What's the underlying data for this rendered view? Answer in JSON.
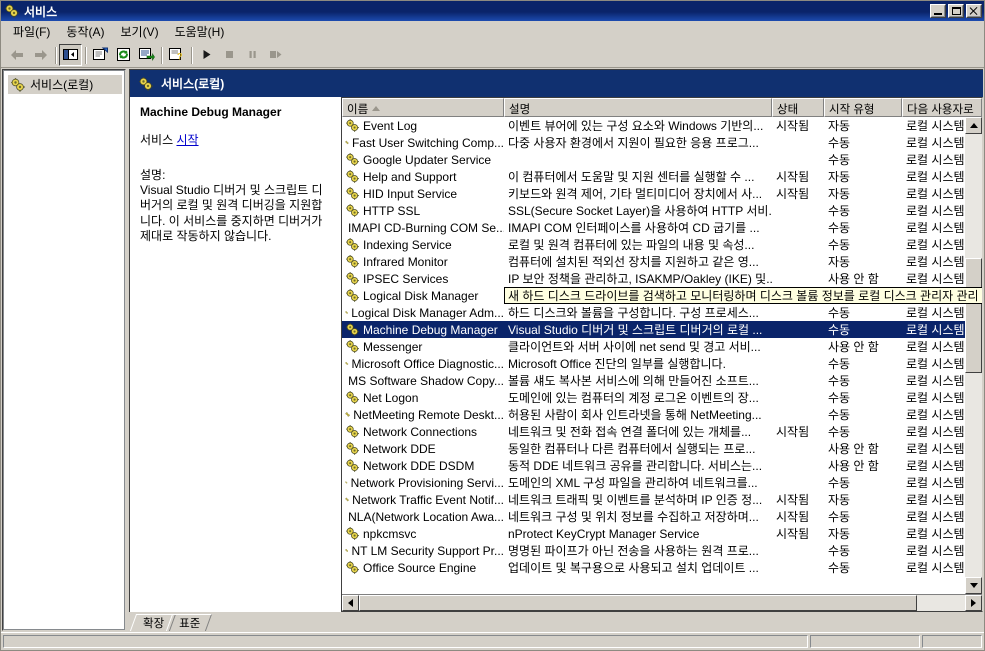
{
  "window": {
    "title": "서비스",
    "icon": "services-gear-icon",
    "buttons": {
      "minimize": "최소화",
      "maximize": "최대화",
      "close": "닫기"
    }
  },
  "menu": [
    {
      "label": "파일(F)",
      "name": "menu-file"
    },
    {
      "label": "동작(A)",
      "name": "menu-action"
    },
    {
      "label": "보기(V)",
      "name": "menu-view"
    },
    {
      "label": "도움말(H)",
      "name": "menu-help"
    }
  ],
  "toolbar": [
    {
      "name": "back-button",
      "icon": "arrow-left-icon",
      "enabled": false
    },
    {
      "name": "forward-button",
      "icon": "arrow-right-icon",
      "enabled": false
    },
    {
      "name": "show-hide-tree-button",
      "icon": "tree-pane-icon",
      "pressed": true
    },
    {
      "name": "properties-button",
      "icon": "properties-icon"
    },
    {
      "name": "refresh-button",
      "icon": "refresh-icon"
    },
    {
      "name": "export-list-button",
      "icon": "export-list-icon"
    },
    {
      "name": "help-button",
      "icon": "help-question-icon"
    },
    {
      "name": "start-service-button",
      "icon": "play-icon"
    },
    {
      "name": "stop-service-button",
      "icon": "stop-icon"
    },
    {
      "name": "pause-service-button",
      "icon": "pause-icon"
    },
    {
      "name": "restart-service-button",
      "icon": "restart-icon"
    }
  ],
  "tree": {
    "root_label": "서비스(로컬)",
    "root_icon": "services-gear-icon"
  },
  "banner": {
    "title": "서비스(로컬)",
    "icon": "services-gear-icon"
  },
  "detail": {
    "service_name": "Machine Debug Manager",
    "action_prefix": "서비스 ",
    "action_link": "시작",
    "description_label": "설명:",
    "description": "Visual Studio 디버거 및 스크립트 디버거의 로컬 및 원격 디버깅을 지원합니다. 이 서비스를 중지하면 디버거가 제대로 작동하지 않습니다."
  },
  "list": {
    "columns": [
      {
        "label": "이름",
        "name": "column-name",
        "sorted": true
      },
      {
        "label": "설명",
        "name": "column-description"
      },
      {
        "label": "상태",
        "name": "column-status"
      },
      {
        "label": "시작 유형",
        "name": "column-startup-type"
      },
      {
        "label": "다음 사용자로",
        "name": "column-log-on-as"
      }
    ],
    "rows": [
      {
        "name": "Event Log",
        "desc": "이벤트 뷰어에 있는 구성 요소와 Windows 기반의...",
        "status": "시작됨",
        "startup": "자동",
        "logon": "로컬 시스템"
      },
      {
        "name": "Fast User Switching Comp...",
        "desc": "다중 사용자 환경에서 지원이 필요한 응용 프로그...",
        "status": "",
        "startup": "수동",
        "logon": "로컬 시스템"
      },
      {
        "name": "Google Updater Service",
        "desc": "",
        "status": "",
        "startup": "수동",
        "logon": "로컬 시스템"
      },
      {
        "name": "Help and Support",
        "desc": "이 컴퓨터에서 도움말 및 지원 센터를 실행할 수 ...",
        "status": "시작됨",
        "startup": "자동",
        "logon": "로컬 시스템"
      },
      {
        "name": "HID Input Service",
        "desc": "키보드와 원격 제어, 기타 멀티미디어 장치에서 사...",
        "status": "시작됨",
        "startup": "자동",
        "logon": "로컬 시스템"
      },
      {
        "name": "HTTP SSL",
        "desc": "SSL(Secure Socket Layer)을 사용하여 HTTP 서비...",
        "status": "",
        "startup": "수동",
        "logon": "로컬 시스템"
      },
      {
        "name": "IMAPI CD-Burning COM Se...",
        "desc": "IMAPI COM 인터페이스를 사용하여 CD 굽기를 ...",
        "status": "",
        "startup": "수동",
        "logon": "로컬 시스템"
      },
      {
        "name": "Indexing Service",
        "desc": "로컬 및 원격 컴퓨터에 있는 파일의 내용 및 속성...",
        "status": "",
        "startup": "수동",
        "logon": "로컬 시스템"
      },
      {
        "name": "Infrared Monitor",
        "desc": "컴퓨터에 설치된 적외선 장치를 지원하고 같은 영...",
        "status": "",
        "startup": "자동",
        "logon": "로컬 시스템"
      },
      {
        "name": "IPSEC Services",
        "desc": "IP 보안 정책을 관리하고, ISAKMP/Oakley (IKE) 및...",
        "status": "",
        "startup": "사용 안 함",
        "logon": "로컬 시스템"
      },
      {
        "name": "Logical Disk Manager",
        "desc": "",
        "status": "",
        "startup": "",
        "logon": ""
      },
      {
        "name": "Logical Disk Manager Adm...",
        "desc": "하드 디스크와 볼륨을 구성합니다. 구성 프로세스...",
        "status": "",
        "startup": "수동",
        "logon": "로컬 시스템"
      },
      {
        "name": "Machine Debug Manager",
        "desc": "Visual Studio 디버거 및 스크립트 디버거의 로컬 ...",
        "status": "",
        "startup": "수동",
        "logon": "로컬 시스템",
        "selected": true
      },
      {
        "name": "Messenger",
        "desc": "클라이언트와 서버 사이에 net send 및 경고 서비...",
        "status": "",
        "startup": "사용 안 함",
        "logon": "로컬 시스템"
      },
      {
        "name": "Microsoft Office Diagnostic...",
        "desc": "Microsoft Office 진단의 일부를 실행합니다.",
        "status": "",
        "startup": "수동",
        "logon": "로컬 시스템"
      },
      {
        "name": "MS Software Shadow Copy...",
        "desc": "볼륨 섀도 복사본 서비스에 의해 만들어진 소프트...",
        "status": "",
        "startup": "수동",
        "logon": "로컬 시스템"
      },
      {
        "name": "Net Logon",
        "desc": "도메인에 있는 컴퓨터의 계정 로그온 이벤트의 장...",
        "status": "",
        "startup": "수동",
        "logon": "로컬 시스템"
      },
      {
        "name": "NetMeeting Remote Deskt...",
        "desc": "허용된 사람이 회사 인트라넷을 통해 NetMeeting...",
        "status": "",
        "startup": "수동",
        "logon": "로컬 시스템"
      },
      {
        "name": "Network Connections",
        "desc": "네트워크 및 전화 접속 연결 폴더에 있는 개체를...",
        "status": "시작됨",
        "startup": "수동",
        "logon": "로컬 시스템"
      },
      {
        "name": "Network DDE",
        "desc": "동일한 컴퓨터나 다른 컴퓨터에서 실행되는 프로...",
        "status": "",
        "startup": "사용 안 함",
        "logon": "로컬 시스템"
      },
      {
        "name": "Network DDE DSDM",
        "desc": "동적 DDE 네트워크 공유를 관리합니다. 서비스는...",
        "status": "",
        "startup": "사용 안 함",
        "logon": "로컬 시스템"
      },
      {
        "name": "Network Provisioning Servi...",
        "desc": "도메인의 XML 구성 파일을 관리하여 네트워크를...",
        "status": "",
        "startup": "수동",
        "logon": "로컬 시스템"
      },
      {
        "name": "Network Traffic Event Notif...",
        "desc": "네트워크 트래픽 및 이벤트를 분석하며 IP 인증 정...",
        "status": "시작됨",
        "startup": "자동",
        "logon": "로컬 시스템"
      },
      {
        "name": "NLA(Network Location Awa...",
        "desc": "네트워크 구성 및 위치 정보를 수집하고 저장하며...",
        "status": "시작됨",
        "startup": "수동",
        "logon": "로컬 시스템"
      },
      {
        "name": "npkcmsvc",
        "desc": "nProtect KeyCrypt Manager Service",
        "status": "시작됨",
        "startup": "자동",
        "logon": "로컬 시스템"
      },
      {
        "name": "NT LM Security Support Pr...",
        "desc": "명명된 파이프가 아닌 전송을 사용하는 원격 프로...",
        "status": "",
        "startup": "수동",
        "logon": "로컬 시스템"
      },
      {
        "name": "Office Source Engine",
        "desc": "업데이트 및 복구용으로 사용되고 설치 업데이트 ...",
        "status": "",
        "startup": "수동",
        "logon": "로컬 시스템"
      }
    ],
    "infotip": {
      "text": "새 하드 디스크 드라이브를 검색하고 모니터링하며 디스크 볼륨 정보를 로컬 디스크 관리자 관리",
      "row_index": 10
    }
  },
  "tabs": [
    {
      "label": "확장",
      "name": "tab-extended",
      "active": true
    },
    {
      "label": "표준",
      "name": "tab-standard",
      "active": false
    }
  ],
  "statusbar": {
    "pane1": "",
    "pane2": "",
    "pane3": ""
  },
  "colors": {
    "face": "#d4d0c8",
    "titlebar": "#0a246a",
    "banner": "#103070",
    "selection": "#0a246a",
    "link": "#0000cc",
    "tooltip_bg": "#ffffe1"
  }
}
